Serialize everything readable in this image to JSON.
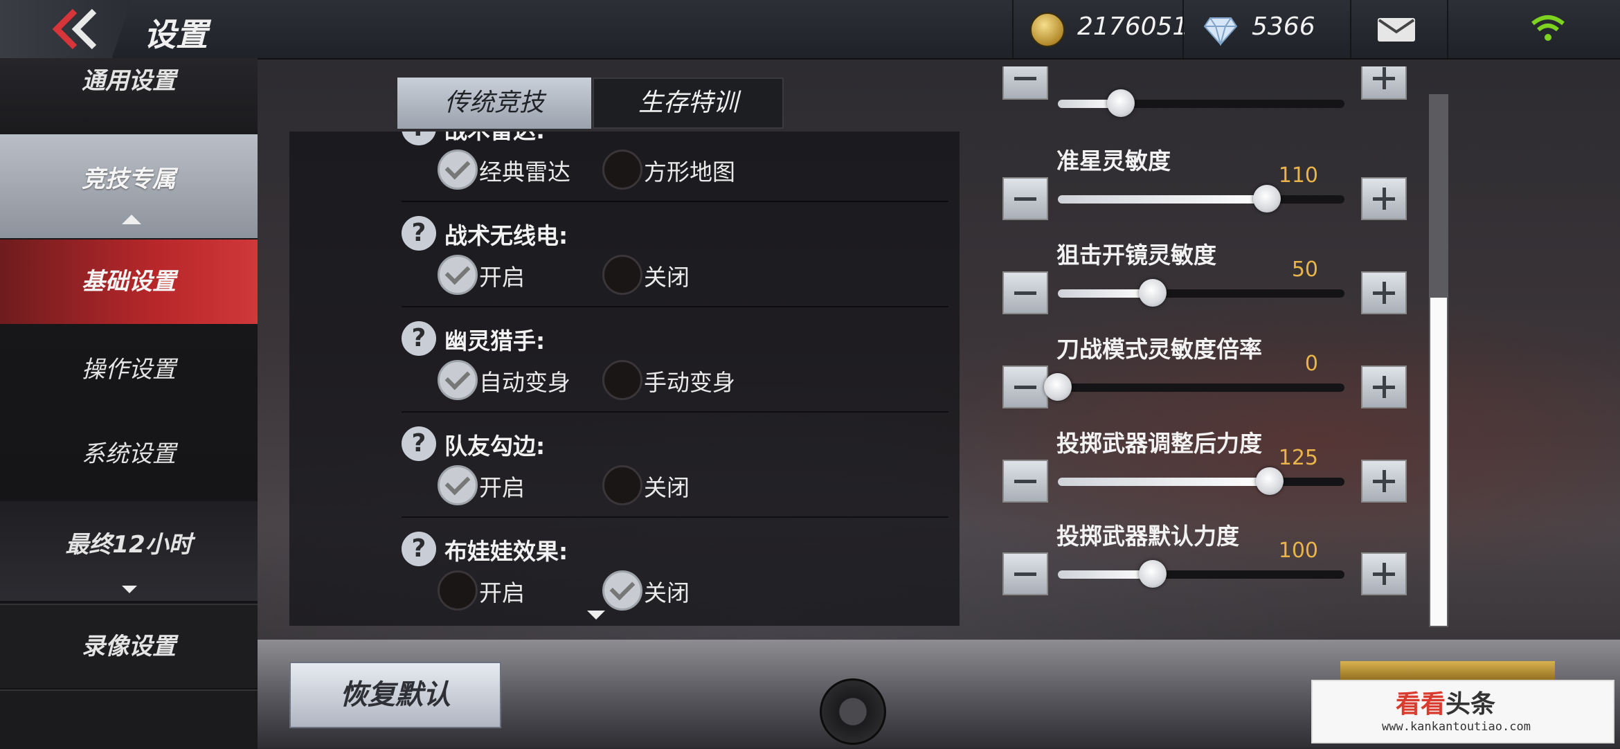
{
  "header": {
    "title": "设置",
    "coins": "2176051",
    "diamonds": "5366",
    "icons": [
      "back-chevron-icon",
      "coin-icon",
      "diamond-icon",
      "mail-icon",
      "wifi-icon"
    ]
  },
  "sidebar": {
    "items": [
      {
        "label": "通用设置"
      },
      {
        "label": "竞技专属",
        "selected": true
      },
      {
        "label": "基础设置",
        "active": true
      },
      {
        "label": "操作设置"
      },
      {
        "label": "系统设置"
      },
      {
        "label": "最终12小时"
      },
      {
        "label": "录像设置"
      }
    ]
  },
  "tabs": [
    {
      "label": "传统竞技",
      "selected": true
    },
    {
      "label": "生存特训",
      "selected": false
    }
  ],
  "options": [
    {
      "title": "战术雷达:",
      "choices": [
        "经典雷达",
        "方形地图"
      ],
      "selected": 0
    },
    {
      "title": "战术无线电:",
      "choices": [
        "开启",
        "关闭"
      ],
      "selected": 0
    },
    {
      "title": "幽灵猎手:",
      "choices": [
        "自动变身",
        "手动变身"
      ],
      "selected": 0
    },
    {
      "title": "队友勾边:",
      "choices": [
        "开启",
        "关闭"
      ],
      "selected": 0
    },
    {
      "title": "布娃娃效果:",
      "choices": [
        "开启",
        "关闭"
      ],
      "selected": 1
    }
  ],
  "sliders": [
    {
      "title": "",
      "value": "",
      "level": 0.22
    },
    {
      "title": "准星灵敏度",
      "value": "110",
      "level": 0.73
    },
    {
      "title": "狙击开镜灵敏度",
      "value": "50",
      "level": 0.33
    },
    {
      "title": "刀战模式灵敏度倍率",
      "value": "0",
      "level": 0.0
    },
    {
      "title": "投掷武器调整后力度",
      "value": "125",
      "level": 0.74
    },
    {
      "title": "投掷武器默认力度",
      "value": "100",
      "level": 0.33
    }
  ],
  "bottom": {
    "restore_label": "恢复默认"
  },
  "watermark": {
    "logo_red": "看看",
    "logo_dark": "头条",
    "url": "www.kankantoutiao.com"
  },
  "colors": {
    "accent_red": "#b7272a",
    "value_gold": "#e9b54a",
    "tab_selected": "#c9cfd8"
  }
}
